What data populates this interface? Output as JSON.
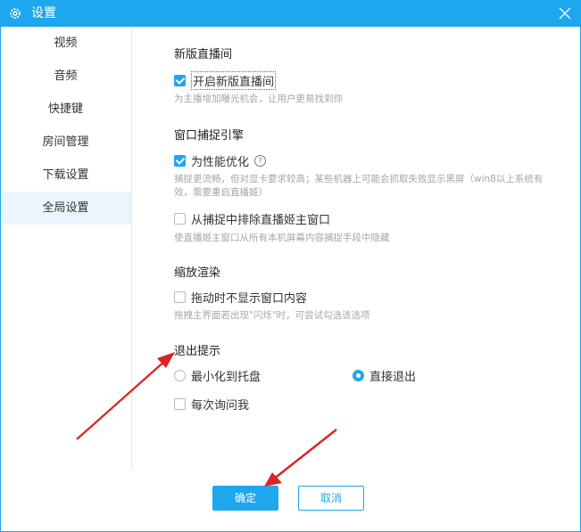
{
  "window": {
    "title": "设置",
    "icons": {
      "settings": "gear-icon",
      "close": "close-icon"
    }
  },
  "sidebar": {
    "items": [
      {
        "label": "视频"
      },
      {
        "label": "音频"
      },
      {
        "label": "快捷键"
      },
      {
        "label": "房间管理"
      },
      {
        "label": "下载设置"
      },
      {
        "label": "全局设置",
        "active": true
      }
    ]
  },
  "sections": {
    "new_room": {
      "title": "新版直播间",
      "option": "开启新版直播间",
      "checked": true,
      "desc": "为主播增加曝光机会，让用户更易找到你"
    },
    "capture": {
      "title": "窗口捕捉引擎",
      "option1": "为性能优化",
      "option1_checked": true,
      "help_icon": "?",
      "desc1": "捕捉更流畅，但对显卡要求较高；某些机器上可能会抓取失败显示黑屏（win8以上系统有效，需要重启直播姬）",
      "option2": "从捕捉中排除直播姬主窗口",
      "option2_checked": false,
      "desc2": "使直播姬主窗口从所有本机屏幕内容捕捉手段中隐藏"
    },
    "scaling": {
      "title": "缩放渲染",
      "option": "拖动时不显示窗口内容",
      "checked": false,
      "desc": "拖拽主界面若出现\"闪烁\"时，可尝试勾选该选项"
    },
    "exit": {
      "title": "退出提示",
      "radio1": "最小化到托盘",
      "radio1_checked": false,
      "radio2": "直接退出",
      "radio2_checked": true,
      "option": "每次询问我",
      "checked": false
    }
  },
  "footer": {
    "ok": "确定",
    "cancel": "取消"
  },
  "colors": {
    "accent": "#1fa7ee",
    "annotation": "#d92525",
    "sidebar_active": "#eaf5fd"
  }
}
